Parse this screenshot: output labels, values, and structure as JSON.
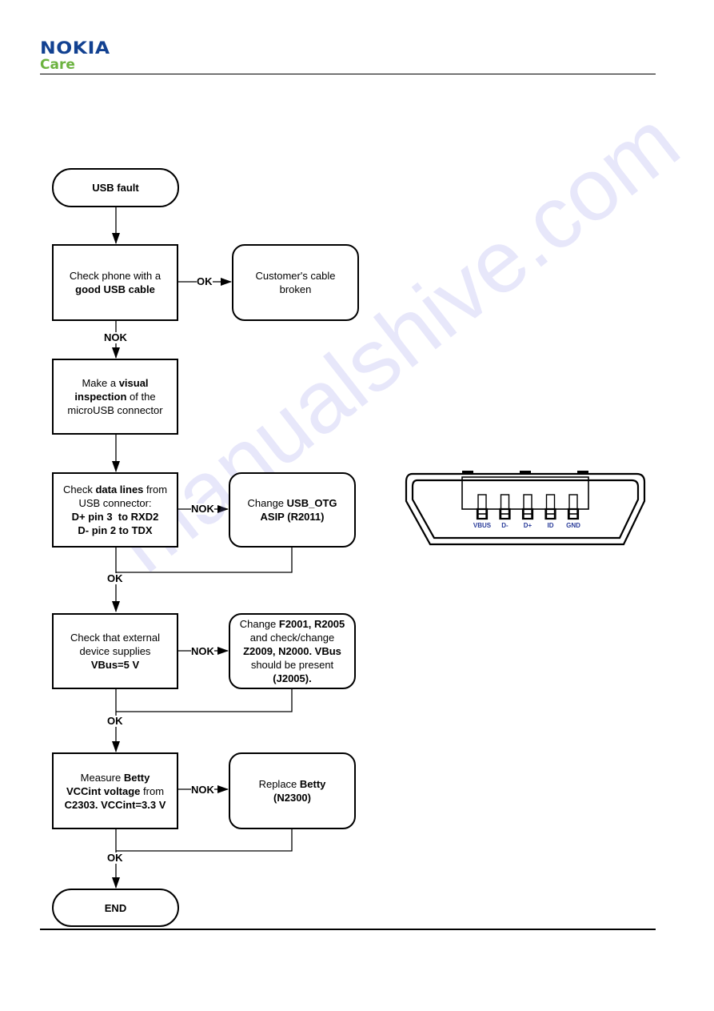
{
  "header": {
    "brand": "NOKIA",
    "sub_brand": "Care"
  },
  "watermark": "manualshive.com",
  "colors": {
    "brand_blue": "#124191",
    "care_green": "#6cb33f",
    "connector_label": "#2a3c9a"
  },
  "flowchart": {
    "start": [
      [
        {
          "t": "USB fault",
          "b": true
        }
      ]
    ],
    "steps": [
      {
        "check": [
          [
            {
              "t": "Check phone with a",
              "b": false
            }
          ],
          [
            {
              "t": "good USB cable",
              "b": true
            }
          ]
        ],
        "branch_label": "OK",
        "action": [
          [
            {
              "t": "Customer's cable",
              "b": false
            }
          ],
          [
            {
              "t": "broken",
              "b": false
            }
          ]
        ],
        "continue_label": "NOK"
      },
      {
        "check": [
          [
            {
              "t": "Make a ",
              "b": false
            },
            {
              "t": "visual",
              "b": true
            }
          ],
          [
            {
              "t": "inspection",
              "b": true
            },
            {
              "t": " of the",
              "b": false
            }
          ],
          [
            {
              "t": "microUSB connector",
              "b": false
            }
          ]
        ]
      },
      {
        "check": [
          [
            {
              "t": "Check ",
              "b": false
            },
            {
              "t": "data lines",
              "b": true
            },
            {
              "t": " from",
              "b": false
            }
          ],
          [
            {
              "t": "USB connector:",
              "b": false
            }
          ],
          [
            {
              "t": "D+ pin 3  to RXD2",
              "b": true
            }
          ],
          [
            {
              "t": "D- pin 2 to TDX",
              "b": true
            }
          ]
        ],
        "branch_label": "NOK",
        "action": [
          [
            {
              "t": "Change ",
              "b": false
            },
            {
              "t": "USB_OTG",
              "b": true
            }
          ],
          [
            {
              "t": "ASIP (R2011)",
              "b": true
            }
          ]
        ],
        "continue_label": "OK"
      },
      {
        "check": [
          [
            {
              "t": "Check that external",
              "b": false
            }
          ],
          [
            {
              "t": "device supplies",
              "b": false
            }
          ],
          [
            {
              "t": "VBus=5 V",
              "b": true
            }
          ]
        ],
        "branch_label": "NOK",
        "action": [
          [
            {
              "t": "Change ",
              "b": false
            },
            {
              "t": "F2001, R2005",
              "b": true
            }
          ],
          [
            {
              "t": "and check/change",
              "b": false
            }
          ],
          [
            {
              "t": "Z2009, N2000. VBus",
              "b": true
            }
          ],
          [
            {
              "t": "should be present",
              "b": false
            }
          ],
          [
            {
              "t": "(J2005).",
              "b": true
            }
          ]
        ],
        "continue_label": "OK"
      },
      {
        "check": [
          [
            {
              "t": "Measure ",
              "b": false
            },
            {
              "t": "Betty",
              "b": true
            }
          ],
          [
            {
              "t": "VCCint voltage",
              "b": true
            },
            {
              "t": " from",
              "b": false
            }
          ],
          [
            {
              "t": "C2303. VCCint=3.3 V",
              "b": true
            }
          ]
        ],
        "branch_label": "NOK",
        "action": [
          [
            {
              "t": "Replace ",
              "b": false
            },
            {
              "t": "Betty",
              "b": true
            }
          ],
          [
            {
              "t": "(N2300)",
              "b": true
            }
          ]
        ],
        "continue_label": "OK"
      }
    ],
    "end": [
      [
        {
          "t": "END",
          "b": true
        }
      ]
    ]
  },
  "connector": {
    "pins": [
      "VBUS",
      "D-",
      "D+",
      "ID",
      "GND"
    ]
  }
}
